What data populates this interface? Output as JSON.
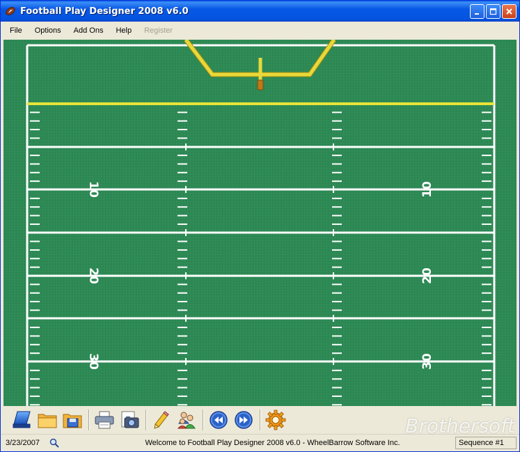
{
  "window": {
    "title": "Football Play Designer 2008 v6.0",
    "icon": "football-icon"
  },
  "menu": {
    "items": [
      {
        "label": "File",
        "enabled": true
      },
      {
        "label": "Options",
        "enabled": true
      },
      {
        "label": "Add Ons",
        "enabled": true
      },
      {
        "label": "Help",
        "enabled": true
      },
      {
        "label": "Register",
        "enabled": false
      }
    ]
  },
  "field": {
    "grass_color": "#2e8a55",
    "line_color": "#ffffff",
    "goal_line_color": "#e8e43a",
    "goalpost_color": "#e8d83a",
    "yard_numbers": {
      "left": [
        "10",
        "20",
        "30"
      ],
      "right": [
        "10",
        "20",
        "30"
      ]
    }
  },
  "toolbar": {
    "buttons": [
      {
        "icon": "new-play-icon",
        "tooltip": ""
      },
      {
        "icon": "open-folder-icon",
        "tooltip": ""
      },
      {
        "icon": "save-icon",
        "tooltip": ""
      },
      {
        "icon": "print-icon",
        "tooltip": ""
      },
      {
        "icon": "camera-icon",
        "tooltip": ""
      },
      {
        "icon": "pencil-icon",
        "tooltip": ""
      },
      {
        "icon": "players-icon",
        "tooltip": ""
      },
      {
        "icon": "previous-icon",
        "tooltip": ""
      },
      {
        "icon": "next-icon",
        "tooltip": ""
      },
      {
        "icon": "gear-icon",
        "tooltip": ""
      }
    ]
  },
  "status": {
    "date": "3/23/2007",
    "message": "Welcome to Football Play Designer 2008 v6.0 - WheelBarrow Software Inc.",
    "sequence": "Sequence #1"
  },
  "watermark": "Brothersoft"
}
